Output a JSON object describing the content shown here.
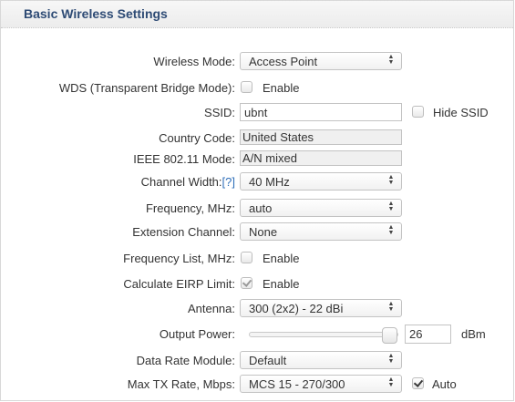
{
  "header": {
    "title": "Basic Wireless Settings"
  },
  "fields": {
    "wireless_mode": {
      "label": "Wireless Mode:",
      "value": "Access Point"
    },
    "wds": {
      "label": "WDS (Transparent Bridge Mode):",
      "checkbox_label": "Enable",
      "checked": false
    },
    "ssid": {
      "label": "SSID:",
      "value": "ubnt",
      "hide_label": "Hide SSID",
      "hide_checked": false
    },
    "country_code": {
      "label": "Country Code:",
      "value": "United States"
    },
    "ieee_mode": {
      "label": "IEEE 802.11 Mode:",
      "value": "A/N mixed"
    },
    "channel_width": {
      "label": "Channel Width:",
      "help": "[?]",
      "value": "40 MHz"
    },
    "frequency": {
      "label": "Frequency, MHz:",
      "value": "auto"
    },
    "extension_channel": {
      "label": "Extension Channel:",
      "value": "None"
    },
    "frequency_list": {
      "label": "Frequency List, MHz:",
      "checkbox_label": "Enable",
      "checked": false
    },
    "eirp_limit": {
      "label": "Calculate EIRP Limit:",
      "checkbox_label": "Enable",
      "checked": true,
      "disabled": true
    },
    "antenna": {
      "label": "Antenna:",
      "value": "300 (2x2) - 22 dBi"
    },
    "output_power": {
      "label": "Output Power:",
      "value": "26",
      "unit": "dBm",
      "level_fraction": 1.0
    },
    "data_rate_module": {
      "label": "Data Rate Module:",
      "value": "Default"
    },
    "max_tx_rate": {
      "label": "Max TX Rate, Mbps:",
      "value": "MCS 15 - 270/300",
      "auto_label": "Auto",
      "auto_checked": true
    }
  },
  "icons": {
    "select_arrows": "updown-arrows-icon",
    "checkmark": "checkmark-icon"
  }
}
